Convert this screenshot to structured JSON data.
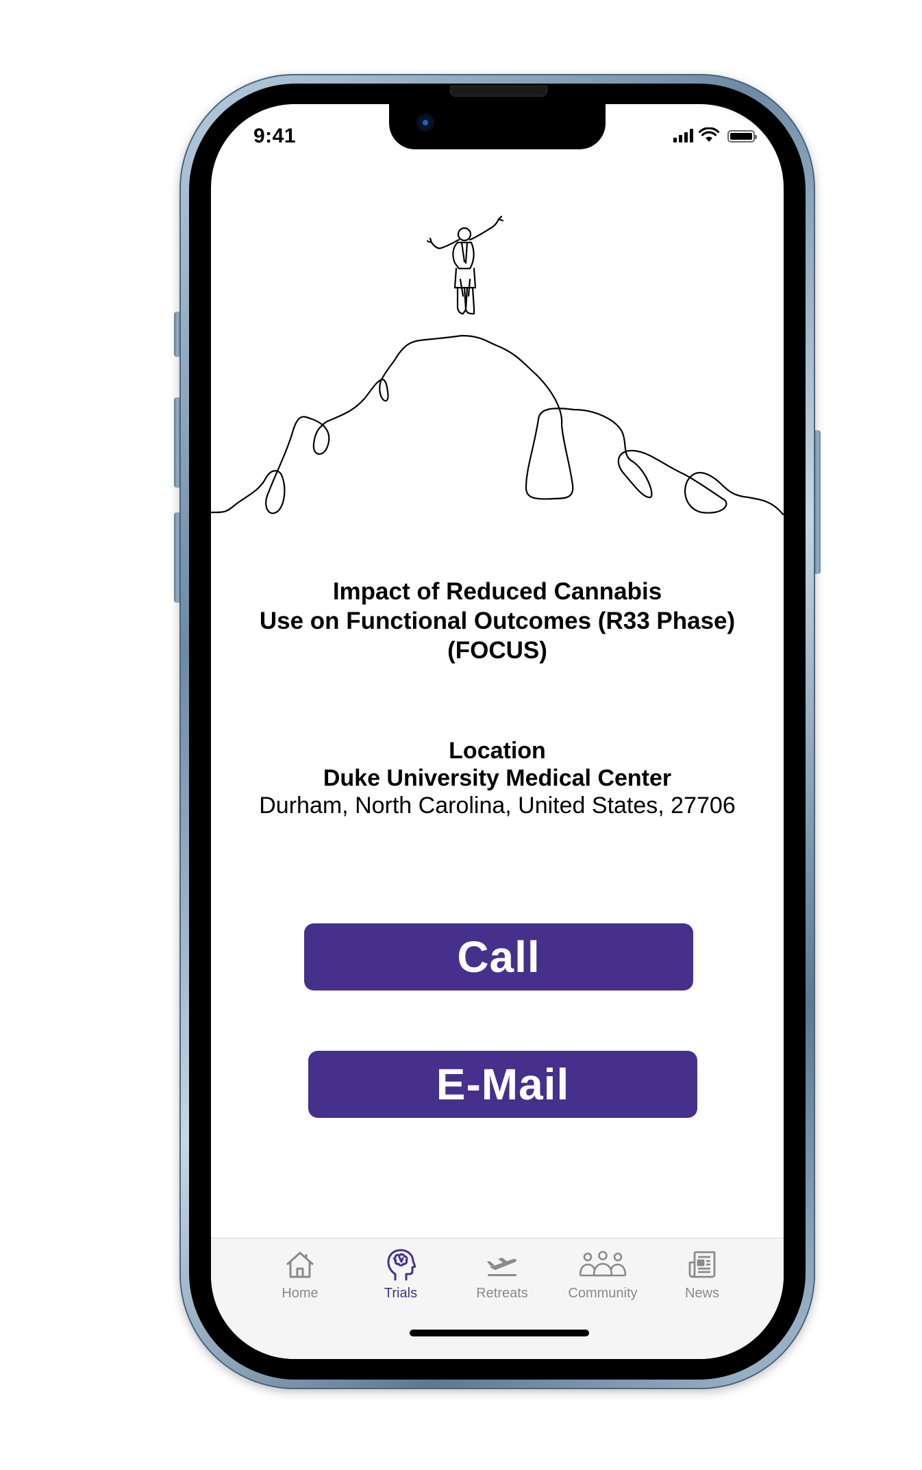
{
  "status_bar": {
    "time": "9:41"
  },
  "trial": {
    "title_line1": "Impact of Reduced Cannabis",
    "title_line2": "Use on Functional Outcomes (R33 Phase)",
    "title_line3": "(FOCUS)"
  },
  "location": {
    "heading": "Location",
    "name": "Duke University Medical Center",
    "address": "Durham, North Carolina, United States, 27706"
  },
  "actions": {
    "call_label": "Call",
    "email_label": "E-Mail"
  },
  "tab_bar": {
    "active_tab": "Trials",
    "tabs": [
      {
        "label": "Home",
        "icon": "home-icon"
      },
      {
        "label": "Trials",
        "icon": "brain-head-icon"
      },
      {
        "label": "Retreats",
        "icon": "plane-departure-icon"
      },
      {
        "label": "Community",
        "icon": "people-group-icon"
      },
      {
        "label": "News",
        "icon": "newspaper-icon"
      }
    ]
  },
  "colors": {
    "accent": "#45318c",
    "inactive_tab": "#8a8a8a",
    "tab_bar_bg": "#f5f5f5",
    "phone_frame": "#7d98b1"
  }
}
